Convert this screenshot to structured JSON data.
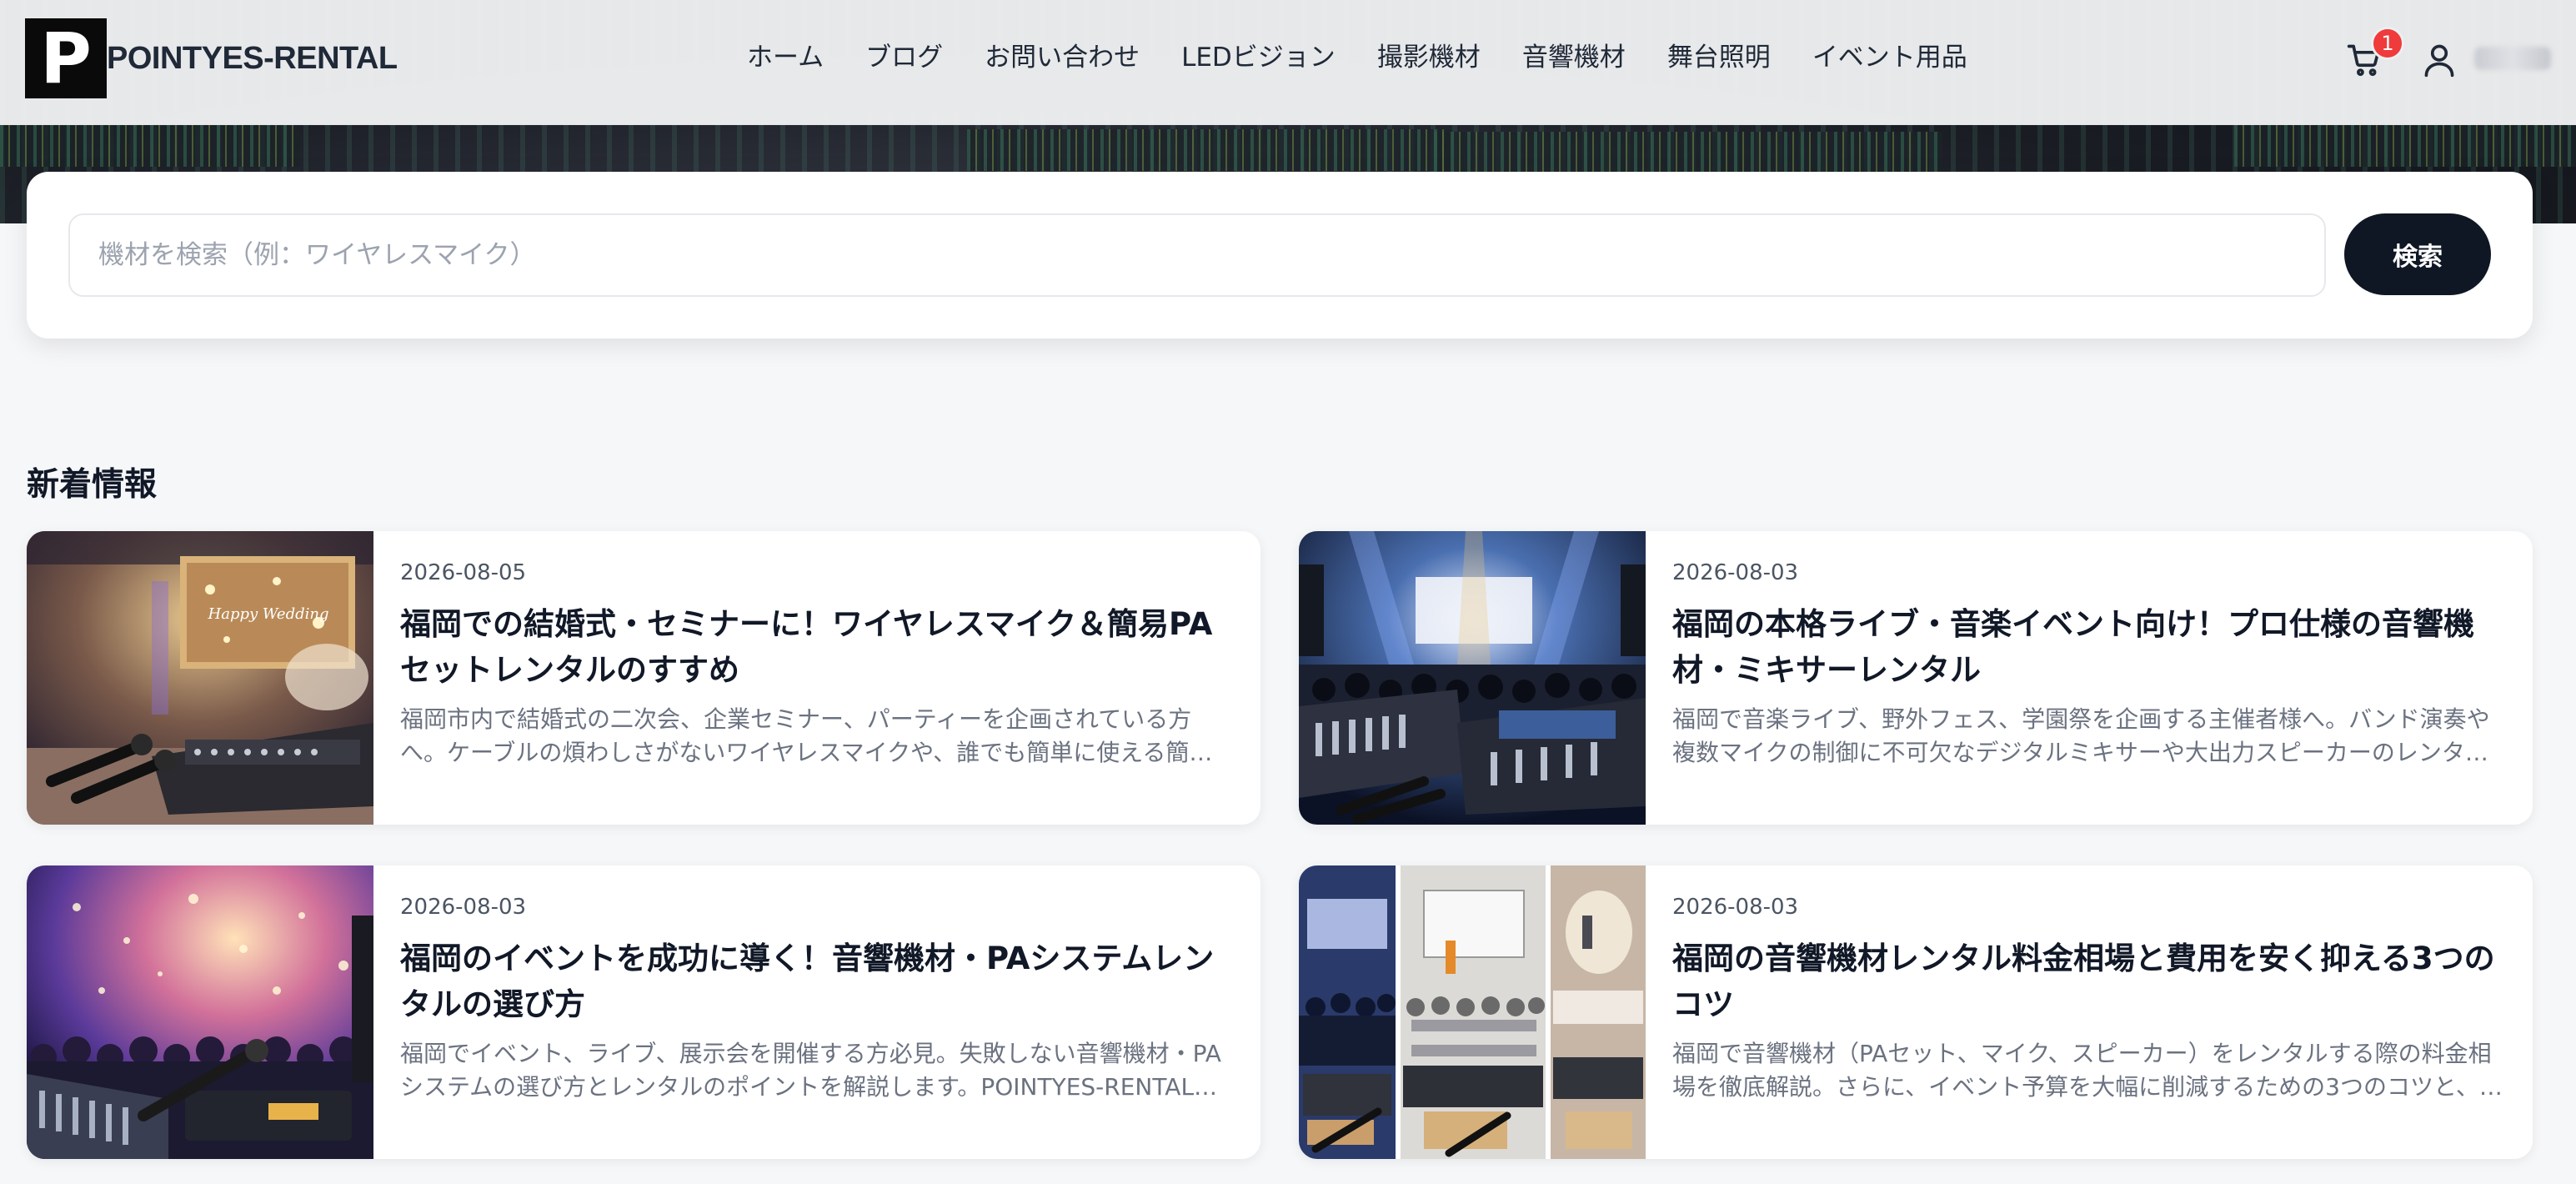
{
  "header": {
    "logo_letter": "P",
    "logo_text": "POINTYES-RENTAL",
    "nav": [
      {
        "label": "ホーム"
      },
      {
        "label": "ブログ"
      },
      {
        "label": "お問い合わせ"
      },
      {
        "label": "LEDビジョン"
      },
      {
        "label": "撮影機材"
      },
      {
        "label": "音響機材"
      },
      {
        "label": "舞台照明"
      },
      {
        "label": "イベント用品"
      }
    ],
    "cart_count": "1"
  },
  "search": {
    "placeholder": "機材を検索（例：ワイヤレスマイク）",
    "button_label": "検索"
  },
  "news": {
    "title": "新着情報",
    "posts": [
      {
        "date": "2026-08-05",
        "title": "福岡での結婚式・セミナーに！ワイヤレスマイク＆簡易PAセットレンタルのすすめ",
        "excerpt": "福岡市内で結婚式の二次会、企業セミナー、パーティーを企画されている方へ。ケーブルの煩わしさがないワイヤレスマイクや、誰でも簡単に使える簡易…",
        "image_text": "Happy Wedding"
      },
      {
        "date": "2026-08-03",
        "title": "福岡の本格ライブ・音楽イベント向け！プロ仕様の音響機材・ミキサーレンタル",
        "excerpt": "福岡で音楽ライブ、野外フェス、学園祭を企画する主催者様へ。バンド演奏や複数マイクの制御に不可欠なデジタルミキサーや大出力スピーカーのレンタル…"
      },
      {
        "date": "2026-08-03",
        "title": "福岡のイベントを成功に導く！音響機材・PAシステムレンタルの選び方",
        "excerpt": "福岡でイベント、ライブ、展示会を開催する方必見。失敗しない音響機材・PAシステムの選び方とレンタルのポイントを解説します。POINTYES-RENTAL…"
      },
      {
        "date": "2026-08-03",
        "title": "福岡の音響機材レンタル料金相場と費用を安く抑える3つのコツ",
        "excerpt": "福岡で音響機材（PAセット、マイク、スピーカー）をレンタルする際の料金相場を徹底解説。さらに、イベント予算を大幅に削減するための3つのコツと、…"
      }
    ]
  }
}
